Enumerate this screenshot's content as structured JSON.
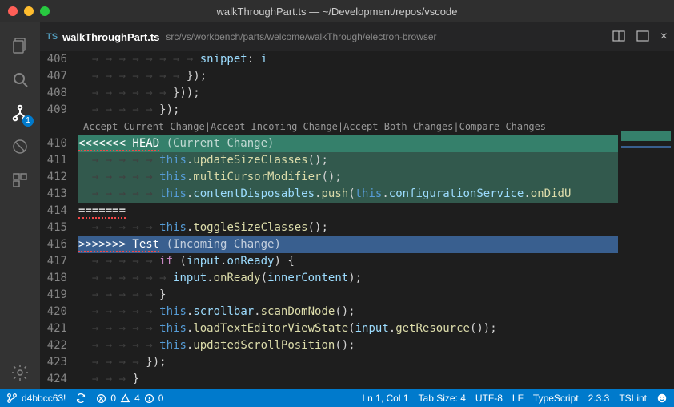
{
  "window": {
    "title": "walkThroughPart.ts — ~/Development/repos/vscode"
  },
  "tab": {
    "icon_label": "TS",
    "filename": "walkThroughPart.ts",
    "breadcrumb": "src/vs/workbench/parts/welcome/walkThrough/electron-browser"
  },
  "activity": {
    "scm_badge": "1"
  },
  "codelens": {
    "accept_current": "Accept Current Change",
    "accept_incoming": "Accept Incoming Change",
    "accept_both": "Accept Both Changes",
    "compare": "Compare Changes"
  },
  "merge": {
    "head_marker": "<<<<<<< HEAD",
    "head_aux": "(Current Change)",
    "sep": "=======",
    "incoming_marker": ">>>>>>> Test",
    "incoming_aux": "(Incoming Change)"
  },
  "lines": {
    "n406": "406",
    "n407": "407",
    "n408": "408",
    "n409": "409",
    "n410": "410",
    "n411": "411",
    "n412": "412",
    "n413": "413",
    "n414": "414",
    "n415": "415",
    "n416": "416",
    "n417": "417",
    "n418": "418",
    "n419": "419",
    "n420": "420",
    "n421": "421",
    "n422": "422",
    "n423": "423",
    "n424": "424"
  },
  "code": {
    "l406_snippet": "snippet",
    "l406_i": "i",
    "l411_update": "updateSizeClasses",
    "l412_multi": "multiCursorModifier",
    "l413_content": "contentDisposables",
    "l413_push": "push",
    "l413_config": "configurationService",
    "l413_ondid": "onDidU",
    "l415_toggle": "toggleSizeClasses",
    "l417_input": "input",
    "l417_onready": "onReady",
    "l418_input": "input",
    "l418_onready": "onReady",
    "l418_inner": "innerContent",
    "l420_scrollbar": "scrollbar",
    "l420_scan": "scanDomNode",
    "l421_load": "loadTextEditorViewState",
    "l421_input": "input",
    "l421_getres": "getResource",
    "l422_updated": "updatedScrollPosition"
  },
  "status": {
    "branch": "d4bbcc63!",
    "errors": "0",
    "warnings": "4",
    "infos": "0",
    "cursor": "Ln 1, Col 1",
    "tabsize": "Tab Size: 4",
    "encoding": "UTF-8",
    "eol": "LF",
    "language": "TypeScript",
    "version": "2.3.3",
    "tslint": "TSLint"
  }
}
